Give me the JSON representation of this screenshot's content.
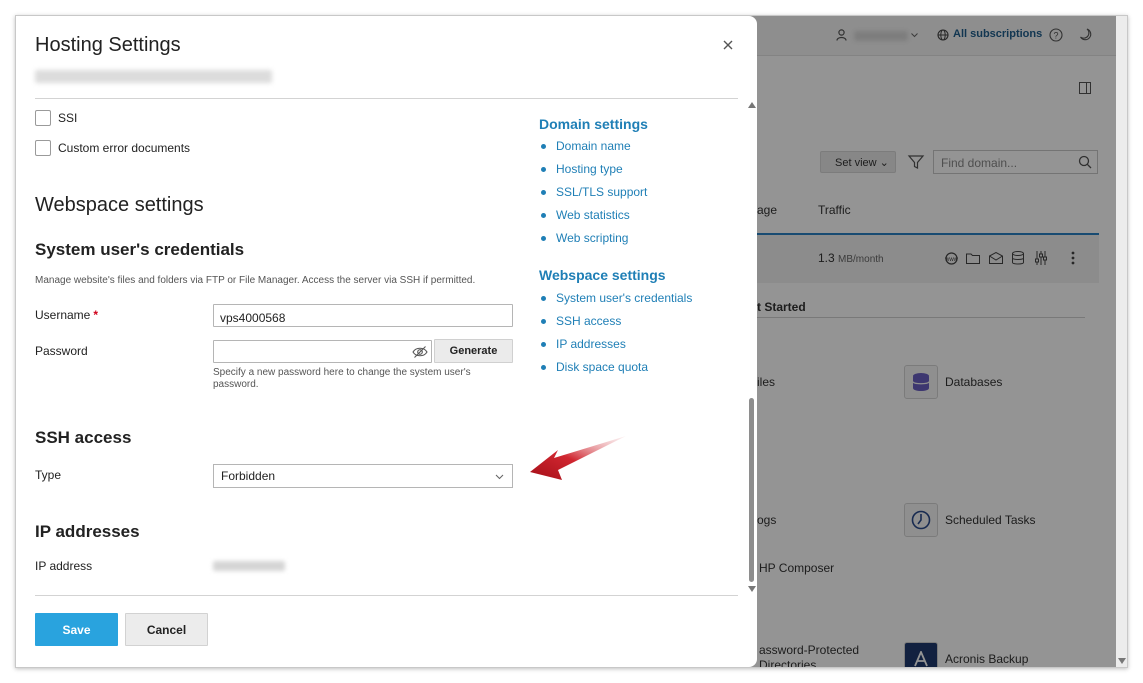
{
  "background": {
    "topbar": {
      "all_subscriptions": "All subscriptions"
    },
    "toolbar": {
      "set_view": "Set view",
      "find_placeholder": "Find domain..."
    },
    "columns": {
      "usage_partial": "age",
      "traffic": "Traffic"
    },
    "row": {
      "traffic_value": "1.3",
      "traffic_unit": "MB/month"
    },
    "get_started_partial": "t Started",
    "tiles": {
      "files_partial": "iles",
      "databases": "Databases",
      "logs_partial": "ogs",
      "scheduled_tasks": "Scheduled Tasks",
      "php_composer_partial": "HP Composer",
      "password_protected_partial": "assword-Protected",
      "directories_partial": "Directories",
      "acronis_backup": "Acronis Backup"
    }
  },
  "modal": {
    "title": "Hosting Settings",
    "checkboxes": [
      {
        "label": "SSI",
        "checked": false
      },
      {
        "label": "Custom error documents",
        "checked": false
      }
    ],
    "webspace_heading": "Webspace settings",
    "credentials": {
      "heading": "System user's credentials",
      "description": "Manage website's files and folders via FTP or File Manager. Access the server via SSH if permitted.",
      "username_label": "Username",
      "required_mark": "*",
      "username_value": "vps4000568",
      "password_label": "Password",
      "password_value": "",
      "generate_label": "Generate",
      "password_hint": "Specify a new password here to change the system user's password."
    },
    "ssh": {
      "heading": "SSH access",
      "type_label": "Type",
      "type_value": "Forbidden"
    },
    "ip": {
      "heading": "IP addresses",
      "ip_label": "IP address"
    },
    "nav": {
      "domain_heading": "Domain settings",
      "domain_links": [
        "Domain name",
        "Hosting type",
        "SSL/TLS support",
        "Web statistics",
        "Web scripting"
      ],
      "webspace_heading": "Webspace settings",
      "webspace_links": [
        "System user's credentials",
        "SSH access",
        "IP addresses",
        "Disk space quota"
      ]
    },
    "footer": {
      "save_label": "Save",
      "cancel_label": "Cancel"
    },
    "colors": {
      "link": "#1f7fb6",
      "primary_button": "#29a3de",
      "required": "#d0021b",
      "annotation_arrow": "#c0141e"
    },
    "icons": {
      "close": "close-icon",
      "password_visibility": "eye-slash-icon",
      "select": "chevron-down-icon"
    }
  }
}
